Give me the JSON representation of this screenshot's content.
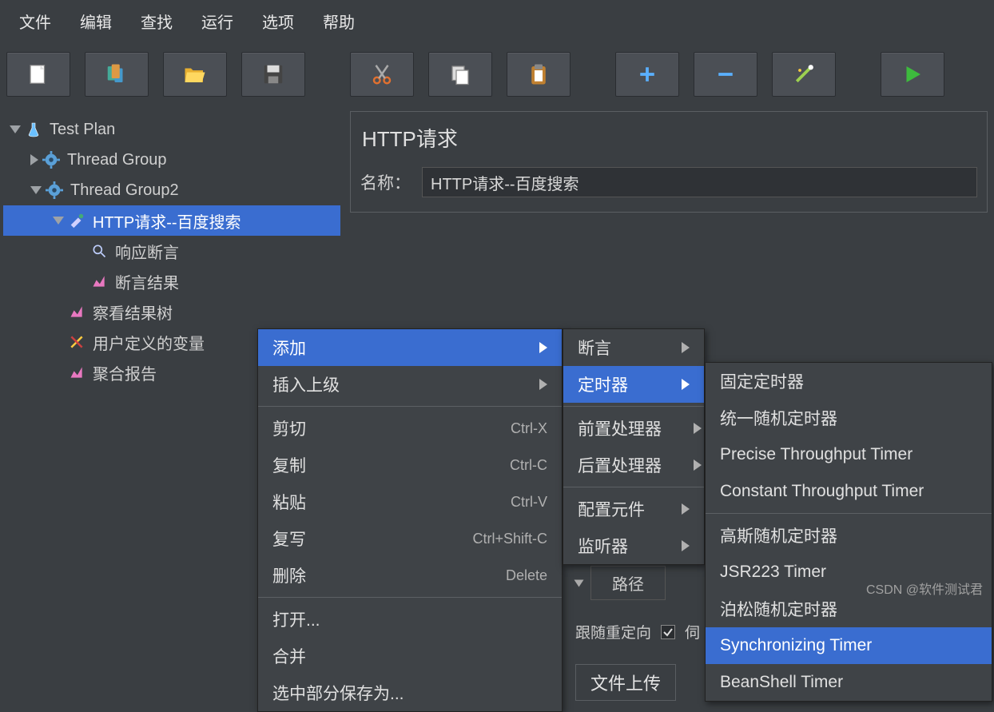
{
  "menubar": [
    "文件",
    "编辑",
    "查找",
    "运行",
    "选项",
    "帮助"
  ],
  "toolbar_icons": [
    "new-file",
    "templates",
    "open",
    "save",
    "cut",
    "copy",
    "paste",
    "plus",
    "minus",
    "wand",
    "play"
  ],
  "tree": {
    "root": "Test Plan",
    "items": [
      {
        "label": "Thread Group",
        "icon": "gear"
      },
      {
        "label": "Thread Group2",
        "icon": "gear"
      },
      {
        "label": "HTTP请求--百度搜索",
        "icon": "sampler",
        "selected": true
      },
      {
        "label": "响应断言",
        "icon": "magnifier"
      },
      {
        "label": "断言结果",
        "icon": "chart"
      },
      {
        "label": "察看结果树",
        "icon": "chart"
      },
      {
        "label": "用户定义的变量",
        "icon": "tools"
      },
      {
        "label": "聚合报告",
        "icon": "chart"
      }
    ]
  },
  "panel": {
    "title": "HTTP请求",
    "name_label": "名称：",
    "name_value": "HTTP请求--百度搜索"
  },
  "context_menu1": [
    {
      "label": "添加",
      "arrow": true,
      "hover": true
    },
    {
      "label": "插入上级",
      "arrow": true
    },
    {
      "sep": true
    },
    {
      "label": "剪切",
      "shortcut": "Ctrl-X"
    },
    {
      "label": "复制",
      "shortcut": "Ctrl-C"
    },
    {
      "label": "粘贴",
      "shortcut": "Ctrl-V"
    },
    {
      "label": "复写",
      "shortcut": "Ctrl+Shift-C"
    },
    {
      "label": "删除",
      "shortcut": "Delete"
    },
    {
      "sep": true
    },
    {
      "label": "打开..."
    },
    {
      "label": "合并"
    },
    {
      "label": "选中部分保存为..."
    }
  ],
  "context_menu2": [
    {
      "label": "断言",
      "arrow": true
    },
    {
      "label": "定时器",
      "arrow": true,
      "hover": true
    },
    {
      "sep": true
    },
    {
      "label": "前置处理器",
      "arrow": true
    },
    {
      "label": "后置处理器",
      "arrow": true
    },
    {
      "sep": true
    },
    {
      "label": "配置元件",
      "arrow": true
    },
    {
      "label": "监听器",
      "arrow": true
    }
  ],
  "context_menu3": [
    {
      "label": "固定定时器"
    },
    {
      "label": "统一随机定时器"
    },
    {
      "label": "Precise Throughput Timer"
    },
    {
      "label": "Constant Throughput Timer"
    },
    {
      "sep": true
    },
    {
      "label": "高斯随机定时器"
    },
    {
      "label": "JSR223 Timer"
    },
    {
      "label": "泊松随机定时器"
    },
    {
      "label": "Synchronizing Timer",
      "hover": true
    },
    {
      "label": "BeanShell Timer"
    }
  ],
  "behind": {
    "path_label": "路径",
    "redirect": "跟随重定向",
    "checked": true,
    "upload": "文件上传",
    "truncated": "伺"
  },
  "watermark": "CSDN @软件测试君"
}
